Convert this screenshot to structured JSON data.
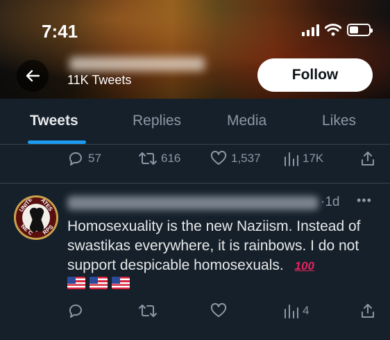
{
  "status_bar": {
    "time": "7:41"
  },
  "profile_header": {
    "tweet_count": "11K Tweets",
    "follow_label": "Follow"
  },
  "tabs": [
    {
      "label": "Tweets",
      "active": true
    },
    {
      "label": "Replies",
      "active": false
    },
    {
      "label": "Media",
      "active": false
    },
    {
      "label": "Likes",
      "active": false
    }
  ],
  "prev_tweet_actions": {
    "replies": "57",
    "retweets": "616",
    "likes": "1,537",
    "views": "17K"
  },
  "tweet": {
    "time": "·1d",
    "more": "•••",
    "text": "Homosexuality is the new Naziism.  Instead of swastikas everywhere, it is rainbows.  I do not support despicable homosexuals.",
    "emoji_100": "100",
    "avatar_text": {
      "top_left": "UNITE",
      "top_right": "ATES",
      "bottom_left": "NE C",
      "bottom_right": "RPS"
    },
    "actions": {
      "views": "4"
    }
  },
  "colors": {
    "background": "#15202b",
    "accent": "#1d9bf0",
    "muted": "#8b98a5",
    "divider": "#38444d"
  }
}
